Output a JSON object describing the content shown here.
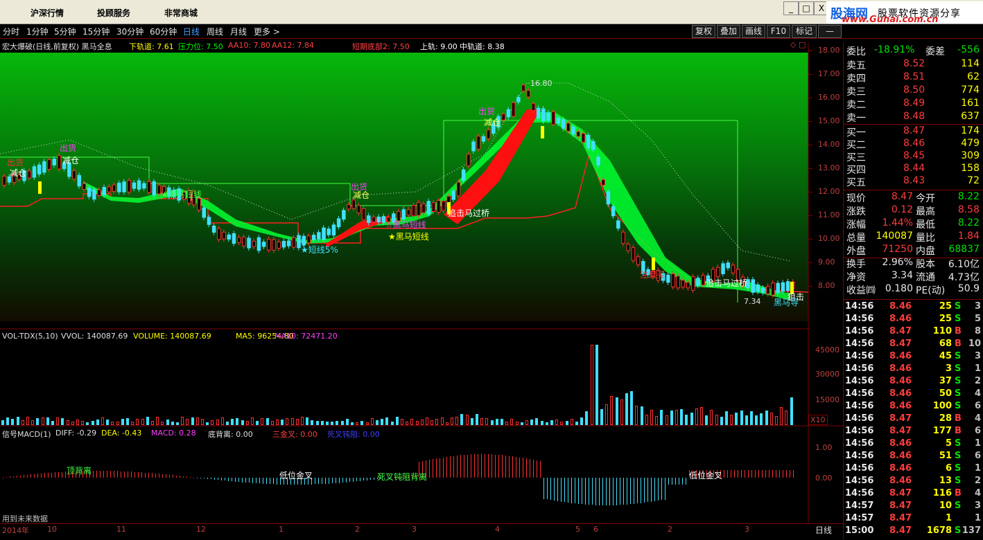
{
  "menu": {
    "items": [
      "沪深行情",
      "投顾服务",
      "非常商城"
    ]
  },
  "window": {
    "min": "_",
    "max": "□",
    "close": "X"
  },
  "brand": {
    "name": "股海网",
    "slogan": "股票软件资源分享",
    "url": "www.Guhai.com.cn"
  },
  "periods": [
    "分时",
    "1分钟",
    "5分钟",
    "15分钟",
    "30分钟",
    "60分钟",
    "日线",
    "周线",
    "月线",
    "更多 >"
  ],
  "toolbar": {
    "buttons": [
      "复权",
      "叠加",
      "画线",
      "F10",
      "标记",
      "—"
    ]
  },
  "main_header": {
    "name": "宏大爆破(日线,前复权) 黑马全息",
    "items": [
      {
        "text": "下轨道: 7.61",
        "color": "#ffff00"
      },
      {
        "text": "压力位: 7.50",
        "color": "#00ff00"
      },
      {
        "text": "AA10: 7.80",
        "color": "#ff4040"
      },
      {
        "text": "AA12: 7.84",
        "color": "#ff4040"
      },
      {
        "text": "短期底部2: 7.50",
        "color": "#ff4040"
      },
      {
        "text": "上轨: 9.00",
        "color": "#ffffff"
      },
      {
        "text": "中轨道: 8.38",
        "color": "#ffffff"
      }
    ]
  },
  "price_axis": [
    "18.00",
    "17.00",
    "16.00",
    "15.00",
    "14.00",
    "13.00",
    "12.00",
    "11.00",
    "10.00",
    "9.00",
    "8.00"
  ],
  "annotations": {
    "high_price": "16.80",
    "low_price": "7.34",
    "labels": [
      "出货",
      "减仓",
      "出货",
      "减仓",
      "出货",
      "减仓",
      "出货",
      "减仓",
      "★黑马短线",
      "★短线5%",
      "★黑马短线",
      "追击马过桥",
      "注意买",
      "追击马过桥",
      "狙击",
      "黑马导",
      "☆黑马短线"
    ]
  },
  "vol_header": {
    "name": "VOL-TDX(5,10)",
    "items": [
      {
        "text": "VVOL: 140087.69",
        "color": "#e0e0e0"
      },
      {
        "text": "VOLUME: 140087.69",
        "color": "#ffff00"
      },
      {
        "text": "MA5: 96254.80",
        "color": "#ffff00"
      },
      {
        "text": "MA10: 72471.20",
        "color": "#ff40ff"
      }
    ]
  },
  "vol_axis": [
    "45000",
    "30000",
    "15000"
  ],
  "vol_unit": "X10",
  "macd_header": {
    "name": "信号MACD(1)",
    "items": [
      {
        "text": "DIFF: -0.29",
        "color": "#e0e0e0"
      },
      {
        "text": "DEA: -0.43",
        "color": "#ffff00"
      },
      {
        "text": "MACD: 0.28",
        "color": "#ff40ff"
      },
      {
        "text": "底背离: 0.00",
        "color": "#e0e0e0"
      },
      {
        "text": "三金叉: 0.00",
        "color": "#ff4040"
      },
      {
        "text": "死叉钝阻: 0.00",
        "color": "#4040ff"
      }
    ]
  },
  "macd_axis": [
    "1.00",
    "0.00"
  ],
  "macd_labels": [
    "顶背离",
    "低位金叉",
    "死叉钝阻背离",
    "低位金叉"
  ],
  "footer_note": "用到未来数据",
  "date_axis": {
    "labels": [
      "2014年",
      "10",
      "11",
      "12",
      "1",
      "2",
      "3",
      "4",
      "5",
      "6",
      "2",
      "3"
    ],
    "mode": "日线"
  },
  "quote": {
    "webi_label": "委比",
    "webi_value": "-18.91%",
    "wecha_label": "委差",
    "wecha_value": "-556",
    "sell": [
      {
        "label": "卖五",
        "price": "8.52",
        "vol": "114"
      },
      {
        "label": "卖四",
        "price": "8.51",
        "vol": "62"
      },
      {
        "label": "卖三",
        "price": "8.50",
        "vol": "774"
      },
      {
        "label": "卖二",
        "price": "8.49",
        "vol": "161"
      },
      {
        "label": "卖一",
        "price": "8.48",
        "vol": "637"
      }
    ],
    "buy": [
      {
        "label": "买一",
        "price": "8.47",
        "vol": "174"
      },
      {
        "label": "买二",
        "price": "8.46",
        "vol": "479"
      },
      {
        "label": "买三",
        "price": "8.45",
        "vol": "309"
      },
      {
        "label": "买四",
        "price": "8.44",
        "vol": "158"
      },
      {
        "label": "买五",
        "price": "8.43",
        "vol": "72"
      }
    ],
    "stats": [
      {
        "l1": "现价",
        "v1": "8.47",
        "c1": "red",
        "l2": "今开",
        "v2": "8.22",
        "c2": "grn"
      },
      {
        "l1": "涨跌",
        "v1": "0.12",
        "c1": "red",
        "l2": "最高",
        "v2": "8.58",
        "c2": "red"
      },
      {
        "l1": "涨幅",
        "v1": "1.44%",
        "c1": "red",
        "l2": "最低",
        "v2": "8.22",
        "c2": "grn"
      },
      {
        "l1": "总量",
        "v1": "140087",
        "c1": "yel",
        "l2": "量比",
        "v2": "1.84",
        "c2": "red"
      },
      {
        "l1": "外盘",
        "v1": "71250",
        "c1": "red",
        "l2": "内盘",
        "v2": "68837",
        "c2": "grn"
      },
      {
        "l1": "换手",
        "v1": "2.96%",
        "c1": "wht",
        "l2": "股本",
        "v2": "6.10亿",
        "c2": "wht"
      },
      {
        "l1": "净资",
        "v1": "3.34",
        "c1": "wht",
        "l2": "流通",
        "v2": "4.73亿",
        "c2": "wht"
      },
      {
        "l1": "收益㈣",
        "v1": "0.180",
        "c1": "wht",
        "l2": "PE(动)",
        "v2": "50.9",
        "c2": "wht"
      }
    ],
    "ticks": [
      {
        "t": "14:56",
        "p": "8.46",
        "v": "25",
        "s": "S",
        "n": "3"
      },
      {
        "t": "14:56",
        "p": "8.46",
        "v": "25",
        "s": "S",
        "n": "5"
      },
      {
        "t": "14:56",
        "p": "8.47",
        "v": "110",
        "s": "B",
        "n": "8"
      },
      {
        "t": "14:56",
        "p": "8.47",
        "v": "68",
        "s": "B",
        "n": "10"
      },
      {
        "t": "14:56",
        "p": "8.46",
        "v": "45",
        "s": "S",
        "n": "3"
      },
      {
        "t": "14:56",
        "p": "8.46",
        "v": "3",
        "s": "S",
        "n": "1"
      },
      {
        "t": "14:56",
        "p": "8.46",
        "v": "37",
        "s": "S",
        "n": "2"
      },
      {
        "t": "14:56",
        "p": "8.46",
        "v": "50",
        "s": "S",
        "n": "4"
      },
      {
        "t": "14:56",
        "p": "8.46",
        "v": "100",
        "s": "S",
        "n": "6"
      },
      {
        "t": "14:56",
        "p": "8.47",
        "v": "28",
        "s": "B",
        "n": "4"
      },
      {
        "t": "14:56",
        "p": "8.47",
        "v": "177",
        "s": "B",
        "n": "6"
      },
      {
        "t": "14:56",
        "p": "8.46",
        "v": "5",
        "s": "S",
        "n": "1"
      },
      {
        "t": "14:56",
        "p": "8.46",
        "v": "51",
        "s": "S",
        "n": "6"
      },
      {
        "t": "14:56",
        "p": "8.46",
        "v": "6",
        "s": "S",
        "n": "1"
      },
      {
        "t": "14:56",
        "p": "8.46",
        "v": "13",
        "s": "S",
        "n": "2"
      },
      {
        "t": "14:56",
        "p": "8.47",
        "v": "116",
        "s": "B",
        "n": "4"
      },
      {
        "t": "14:57",
        "p": "8.47",
        "v": "10",
        "s": "S",
        "n": "3"
      },
      {
        "t": "14:57",
        "p": "8.47",
        "v": "1",
        "s": "",
        "n": "1"
      },
      {
        "t": "15:00",
        "p": "8.47",
        "v": "1678",
        "s": "S",
        "n": "137"
      }
    ]
  }
}
